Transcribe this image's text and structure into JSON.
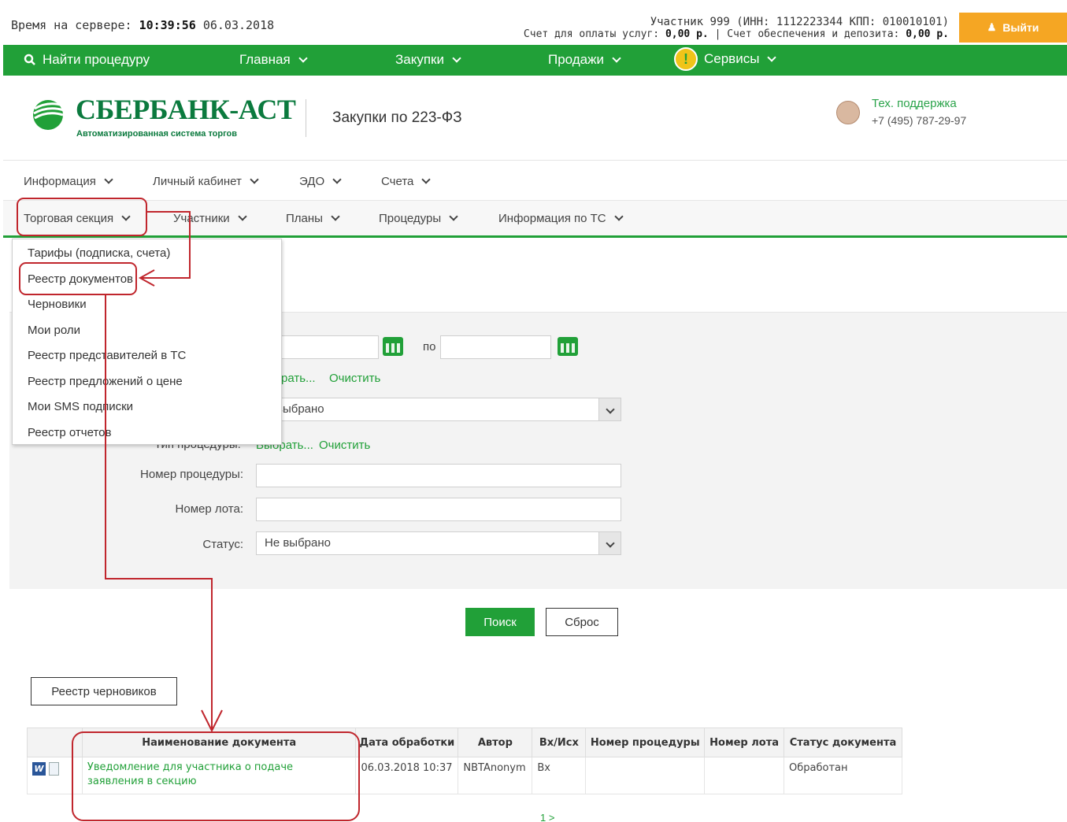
{
  "topbar": {
    "server_time_label": "Время на сервере:",
    "server_time": "10:39:56",
    "server_date": "06.03.2018",
    "participant_line": "Участник 999 (ИНН: 1112223344 КПП: 010010101)",
    "billing_label": "Счет для оплаты услуг:",
    "billing_value": "0,00 р.",
    "deposit_label": "| Счет обеспечения и депозита:",
    "deposit_value": "0,00 р.",
    "logout_label": "Выйти"
  },
  "greennav": {
    "find": "Найти процедуру",
    "main": "Главная",
    "purchases": "Закупки",
    "sales": "Продажи",
    "services": "Сервисы",
    "alert_glyph": "!"
  },
  "header": {
    "logo_title": "СБЕРБАНК-АСТ",
    "logo_subtitle": "Автоматизированная система торгов",
    "section": "Закупки по 223-ФЗ",
    "support_label": "Тех. поддержка",
    "support_phone": "+7 (495) 787-29-97"
  },
  "menu_row1": [
    "Информация",
    "Личный кабинет",
    "ЭДО",
    "Счета"
  ],
  "menu_row2": [
    "Торговая секция",
    "Участники",
    "Планы",
    "Процедуры",
    "Информация по ТС"
  ],
  "dropdown": [
    "Тарифы (подписка, счета)",
    "Реестр документов",
    "Черновики",
    "Мои роли",
    "Реестр представителей в ТС",
    "Реестр предложений о цене",
    "Мои SMS подписки",
    "Реестр отчетов"
  ],
  "form": {
    "date_to_label": "по",
    "select_link_1": "рать...",
    "clear_link_1": "Очистить",
    "select_value_1": "выбрано",
    "proc_type_label": "Тип процедуры:",
    "select_link_2": "Выбрать...",
    "clear_link_2": "Очистить",
    "proc_number_label": "Номер процедуры:",
    "lot_number_label": "Номер лота:",
    "status_label": "Статус:",
    "status_value": "Не выбрано"
  },
  "buttons": {
    "search": "Поиск",
    "reset": "Сброс",
    "drafts": "Реестр черновиков"
  },
  "table": {
    "headers": [
      "",
      "Наименование документа",
      "Дата обработки",
      "Автор",
      "Вх/Исх",
      "Номер процедуры",
      "Номер лота",
      "Статус документа"
    ],
    "rows": [
      {
        "icon_word": "W",
        "name": "Уведомление для участника о подаче заявления в секцию",
        "date": "06.03.2018 10:37",
        "author": "NBTAnonym",
        "direction": "Вх",
        "proc_number": "",
        "lot_number": "",
        "status": "Обработан"
      }
    ],
    "pager": "1 >"
  },
  "colors": {
    "brand_green": "#21a038",
    "logout_orange": "#f5a623",
    "annotation_red": "#c0262d"
  }
}
